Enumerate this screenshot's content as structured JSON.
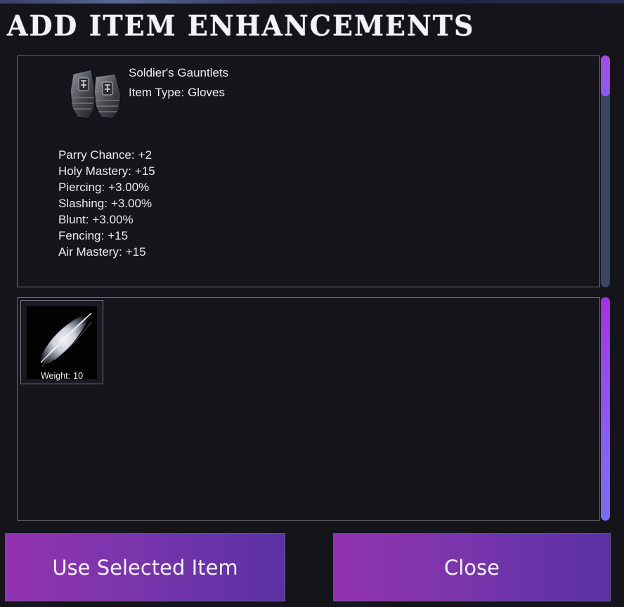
{
  "window": {
    "title": "ADD ITEM ENHANCEMENTS"
  },
  "item": {
    "name": "Soldier's Gauntlets",
    "type_label": "Item Type:",
    "type_value": "Gloves",
    "icon": "gauntlets-icon",
    "stats": [
      {
        "name": "Parry Chance:",
        "value": "+2"
      },
      {
        "name": "Holy Mastery:",
        "value": "+15"
      },
      {
        "name": "Piercing:",
        "value": "+3.00%"
      },
      {
        "name": "Slashing:",
        "value": "+3.00%"
      },
      {
        "name": "Blunt:",
        "value": "+3.00%"
      },
      {
        "name": "Fencing:",
        "value": "+15"
      },
      {
        "name": "Air Mastery:",
        "value": "+15"
      }
    ]
  },
  "enhancements": [
    {
      "icon": "feather-icon",
      "weight_label": "Weight:",
      "weight_value": "10"
    }
  ],
  "buttons": {
    "use_label": "Use Selected Item",
    "close_label": "Close"
  },
  "colors": {
    "background": "#16141b",
    "panel_border": "#6b6872",
    "accent_purple": "#9233b1",
    "accent_indigo": "#5a31a3",
    "scroll_thumb": "#a24de6"
  }
}
